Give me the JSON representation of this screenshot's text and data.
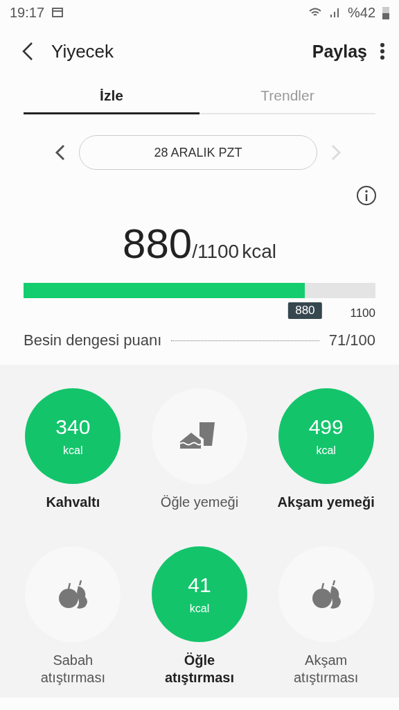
{
  "status_bar": {
    "time": "19:17",
    "battery": "%42"
  },
  "header": {
    "title": "Yiyecek",
    "share": "Paylaş"
  },
  "tabs": [
    {
      "label": "İzle",
      "selected": true
    },
    {
      "label": "Trendler",
      "selected": false
    }
  ],
  "date": {
    "label": "28 ARALIK PZT",
    "next_disabled": true
  },
  "summary": {
    "consumed": "880",
    "target": "/1100",
    "unit": "kcal",
    "level": 0.8,
    "marker": "880",
    "max": "1100"
  },
  "score": {
    "label": "Besin dengesi puanı",
    "value": "71/100"
  },
  "meals": [
    {
      "kind": "logged",
      "value": "340",
      "unit": "kcal",
      "label": "Kahvaltı"
    },
    {
      "kind": "empty-meal",
      "label": "Öğle yemeği"
    },
    {
      "kind": "logged",
      "value": "499",
      "unit": "kcal",
      "label": "Akşam yemeği"
    },
    {
      "kind": "empty-snack",
      "label": "Sabah atıştırması"
    },
    {
      "kind": "logged",
      "value": "41",
      "unit": "kcal",
      "label": "Öğle atıştırması"
    },
    {
      "kind": "empty-snack",
      "label": "Akşam atıştırması"
    }
  ]
}
